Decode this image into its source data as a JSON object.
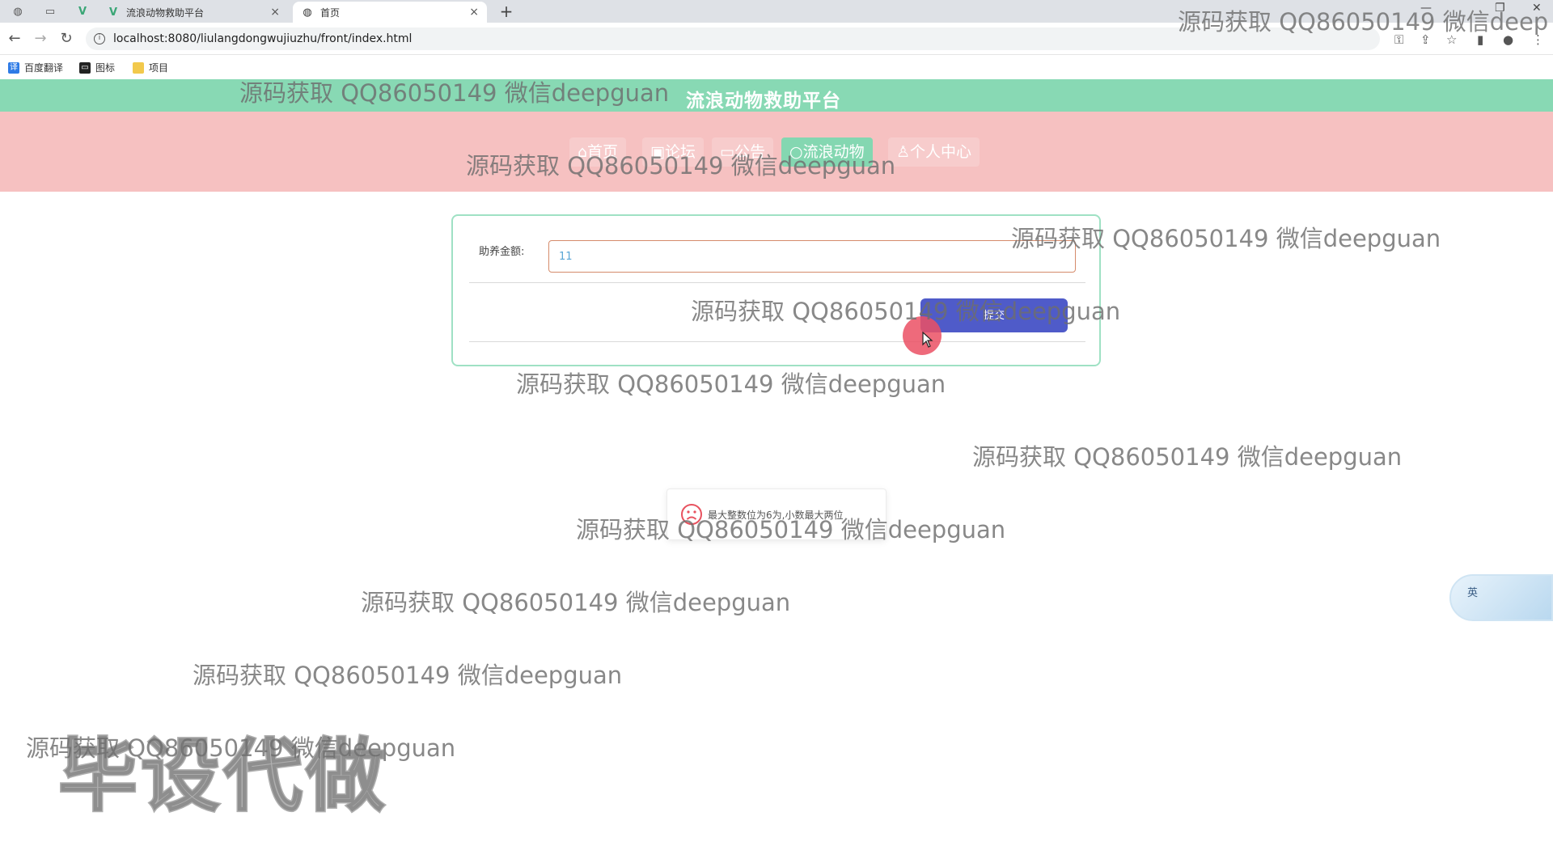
{
  "browser": {
    "tabs": [
      {
        "label": "流浪动物救助平台",
        "active": false
      },
      {
        "label": "首页",
        "active": true
      }
    ],
    "url": "localhost:8080/liulangdongwujiuzhu/front/index.html",
    "bookmarks": [
      {
        "label": "百度翻译",
        "icon": "translate-icon"
      },
      {
        "label": "图标",
        "icon": "folder-dark-icon"
      },
      {
        "label": "项目",
        "icon": "folder-yellow-icon"
      }
    ]
  },
  "site": {
    "title": "流浪动物救助平台",
    "nav": [
      {
        "label": "⌂首页",
        "active": false
      },
      {
        "label": "▣论坛",
        "active": false
      },
      {
        "label": "▭公告",
        "active": false
      },
      {
        "label": "○流浪动物",
        "active": true
      },
      {
        "label": "♙个人中心",
        "active": false
      }
    ]
  },
  "form": {
    "amount_label": "助养金额:",
    "amount_value": "11",
    "submit_label": "提交"
  },
  "toast": {
    "message": "最大整数位为6为,小数最大两位"
  },
  "ime": {
    "label": "英"
  },
  "overlay": {
    "watermark": "源码获取 QQ86050149 微信deepguan",
    "watermark_partial": "源码获取 QQ86050149 微信deep",
    "stamp": "毕设代做"
  },
  "colors": {
    "header": "#88d9b4",
    "nav_bg": "#f6c1c1",
    "nav_active": "#84d7b1",
    "card_border": "#9fe1c4",
    "submit": "#4f5bc9",
    "input_border": "#d58b6b"
  }
}
